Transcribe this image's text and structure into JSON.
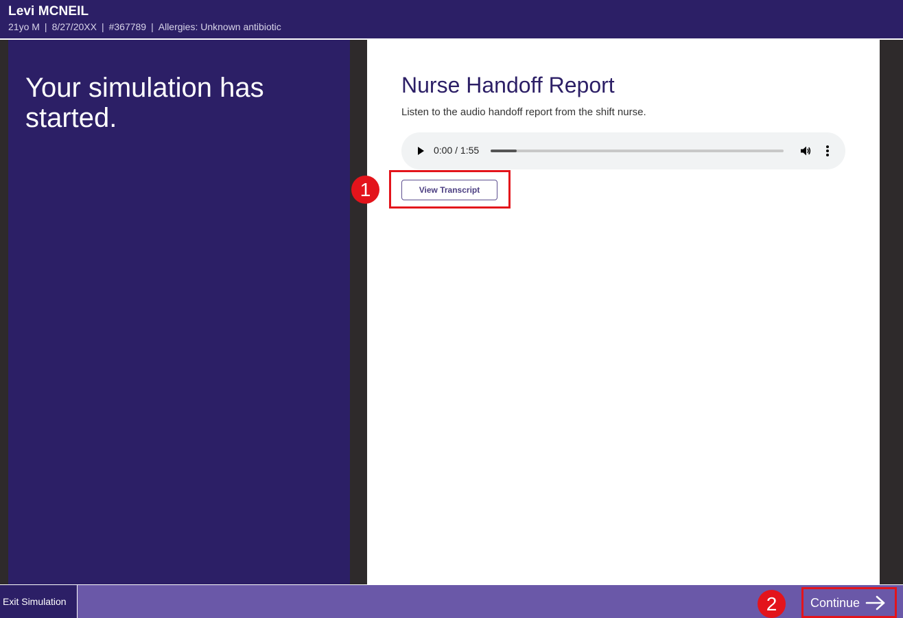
{
  "header": {
    "patient_name": "Levi MCNEIL",
    "age_sex": "21yo M",
    "dob": "8/27/20XX",
    "mrn": "#367789",
    "allergies": "Allergies: Unknown antibiotic",
    "separator": "|"
  },
  "left_panel": {
    "heading": "Your simulation has started."
  },
  "content": {
    "title": "Nurse Handoff Report",
    "instructions": "Listen to the audio handoff report from the shift nurse.",
    "audio": {
      "time": "0:00 / 1:55",
      "progress_fraction": 0.09,
      "play_icon": "play-icon",
      "volume_icon": "volume-icon",
      "more_icon": "more-vertical-icon"
    },
    "transcript_label": "View Transcript"
  },
  "annotations": {
    "marker_1": "1",
    "marker_2": "2",
    "highlight_color": "#e3141b"
  },
  "footer": {
    "exit_label": "Exit Simulation",
    "continue_label": "Continue",
    "continue_icon": "arrow-right-icon"
  },
  "colors": {
    "brand_dark": "#2c1f66",
    "footer_purple": "#6a58a8",
    "frame_gray": "#2e2a2b"
  }
}
